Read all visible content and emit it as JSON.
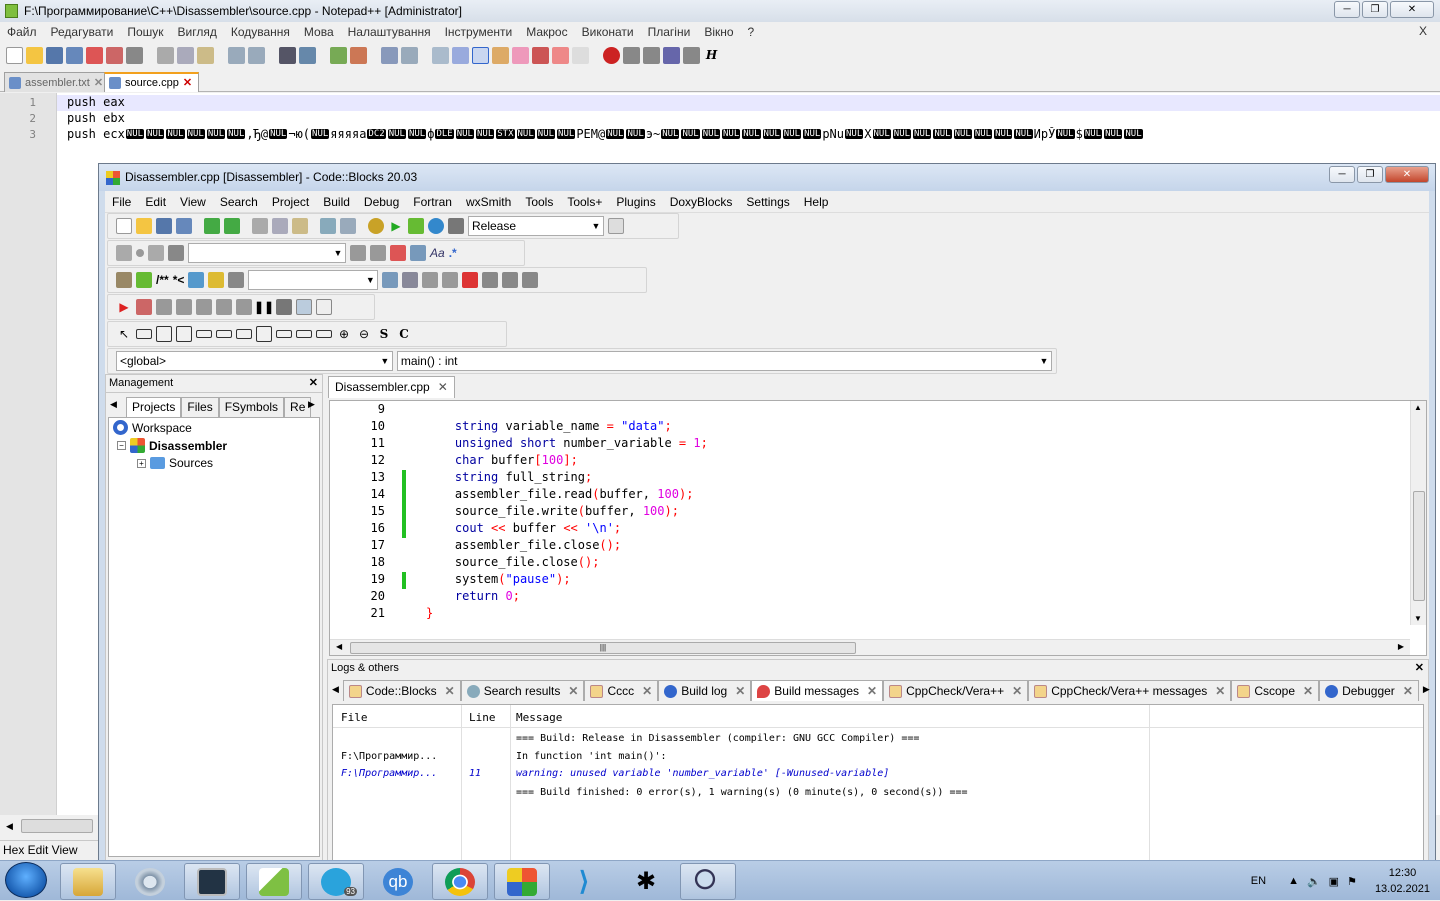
{
  "npp": {
    "title": "F:\\Программирование\\C++\\Disassembler\\source.cpp - Notepad++ [Administrator]",
    "menu": [
      "Файл",
      "Редагувати",
      "Пошук",
      "Вигляд",
      "Кодування",
      "Мова",
      "Налаштування",
      "Інструменти",
      "Макрос",
      "Виконати",
      "Плагіни",
      "Вікно",
      "?"
    ],
    "menu_close": "X",
    "tabs": [
      {
        "label": "assembler.txt",
        "active": false
      },
      {
        "label": "source.cpp",
        "active": true
      }
    ],
    "lines": [
      {
        "num": "1",
        "text": "push eax"
      },
      {
        "num": "2",
        "text": "push ebx"
      },
      {
        "num": "3",
        "text": "push ecx"
      }
    ],
    "line3_tail_segments": [
      "NUL",
      "NUL",
      "NUL",
      "NUL",
      "NUL",
      "NUL",
      ",Ђ@",
      "NUL",
      "¬ю(",
      "NUL",
      "яяяяа",
      "DC2",
      "NUL",
      "NUL",
      "ф",
      "DLE",
      "NUL",
      "NUL",
      "STX",
      "NUL",
      "NUL",
      "NUL",
      "PEM@",
      "NUL",
      "NUL",
      " э~",
      "NUL",
      "NUL",
      "NUL",
      "NUL",
      "NUL",
      "NUL",
      "NUL",
      "NUL",
      "pNu",
      "NUL",
      "X",
      "NUL",
      "NUL",
      "NUL",
      "NUL",
      "NUL",
      "NUL",
      "NUL",
      "NUL",
      "ИрЎ",
      "NUL",
      "$",
      "NUL",
      "NUL",
      "NUL"
    ],
    "status": "Hex Edit View"
  },
  "cb": {
    "title": "Disassembler.cpp [Disassembler] - Code::Blocks 20.03",
    "menu": [
      "File",
      "Edit",
      "View",
      "Search",
      "Project",
      "Build",
      "Debug",
      "Fortran",
      "wxSmith",
      "Tools",
      "Tools+",
      "Plugins",
      "DoxyBlocks",
      "Settings",
      "Help"
    ],
    "build_target": "Release",
    "scope_select": "<global>",
    "function_select": "main() : int",
    "toolbar3_text": [
      "/**",
      "*<"
    ],
    "toolbar2_text": [
      "Aa",
      ".*"
    ],
    "management": {
      "title": "Management",
      "tabs": [
        "Projects",
        "Files",
        "FSymbols",
        "Re"
      ],
      "tree": [
        {
          "label": "Workspace",
          "level": 0
        },
        {
          "label": "Disassembler",
          "level": 1
        },
        {
          "label": "Sources",
          "level": 2
        }
      ]
    },
    "editor": {
      "tab": "Disassembler.cpp",
      "lines": [
        {
          "n": "9",
          "code": ""
        },
        {
          "n": "10",
          "code": "    string variable_name = \"data\";"
        },
        {
          "n": "11",
          "code": "    unsigned short number_variable = 1;"
        },
        {
          "n": "12",
          "code": "    char buffer[100];"
        },
        {
          "n": "13",
          "code": "    string full_string;"
        },
        {
          "n": "14",
          "code": "    assembler_file.read(buffer, 100);"
        },
        {
          "n": "15",
          "code": "    source_file.write(buffer, 100);"
        },
        {
          "n": "16",
          "code": "    cout << buffer << '\\n';"
        },
        {
          "n": "17",
          "code": "    assembler_file.close();"
        },
        {
          "n": "18",
          "code": "    source_file.close();"
        },
        {
          "n": "19",
          "code": "    system(\"pause\");"
        },
        {
          "n": "20",
          "code": "    return 0;"
        },
        {
          "n": "21",
          "code": "}"
        }
      ],
      "modified_lines": [
        "13",
        "14",
        "15",
        "16",
        "19"
      ]
    },
    "logs": {
      "title": "Logs & others",
      "tabs": [
        "Code::Blocks",
        "Search results",
        "Cccc",
        "Build log",
        "Build messages",
        "CppCheck/Vera++",
        "CppCheck/Vera++ messages",
        "Cscope",
        "Debugger"
      ],
      "active_tab": "Build messages",
      "columns": [
        "File",
        "Line",
        "Message"
      ],
      "rows": [
        {
          "file": "",
          "line": "",
          "message": "=== Build: Release in Disassembler (compiler: GNU GCC Compiler) ===",
          "kind": "info"
        },
        {
          "file": "F:\\Программир...",
          "line": "",
          "message": "In function 'int main()':",
          "kind": "info"
        },
        {
          "file": "F:\\Программир...",
          "line": "11",
          "message": "warning: unused variable 'number_variable' [-Wunused-variable]",
          "kind": "warning"
        },
        {
          "file": "",
          "line": "",
          "message": "=== Build finished: 0 error(s), 1 warning(s) (0 minute(s), 0 second(s)) ===",
          "kind": "info"
        }
      ]
    }
  },
  "taskbar": {
    "lang": "EN",
    "time": "12:30",
    "date": "13.02.2021",
    "telegram_badge": "93",
    "qb_label": "qb",
    "apps": [
      "explorer",
      "settings",
      "terminal",
      "notepad-plus-plus",
      "telegram",
      "qbittorrent",
      "chrome",
      "codeblocks",
      "vscode",
      "debugger",
      "search-tool"
    ]
  },
  "colors": {
    "keyword": "#0000a0",
    "string": "#0000ff",
    "number": "#e000e0",
    "operator": "#ff0000",
    "changebar": "#22c022",
    "warning": "#0000cc"
  }
}
